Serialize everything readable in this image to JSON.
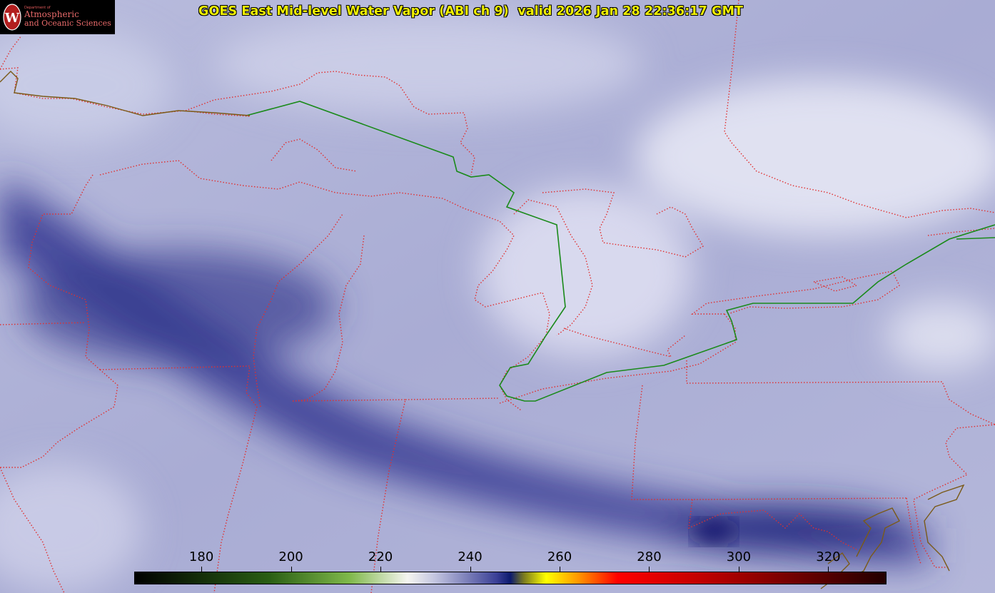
{
  "title": "GOES East Mid-level Water Vapor (ABI ch 9)  valid 2026 Jan 28 22:36:17 GMT",
  "logo": {
    "department": "Department of",
    "line1": "Atmospheric",
    "line2": "and Oceanic Sciences",
    "seal_letter": "W"
  },
  "colorbar": {
    "min": 165,
    "max": 333,
    "ticks": [
      180,
      200,
      220,
      240,
      260,
      280,
      300,
      320
    ],
    "stops": [
      {
        "value": 165,
        "color": "#000000"
      },
      {
        "value": 195,
        "color": "#2a5e14"
      },
      {
        "value": 213,
        "color": "#7fb84a"
      },
      {
        "value": 226,
        "color": "#f5f5f0"
      },
      {
        "value": 232,
        "color": "#c4c6e0"
      },
      {
        "value": 246,
        "color": "#3a3f96"
      },
      {
        "value": 249,
        "color": "#0c1a6e"
      },
      {
        "value": 252,
        "color": "#7a7a20"
      },
      {
        "value": 257,
        "color": "#ffff00"
      },
      {
        "value": 264,
        "color": "#ff9a00"
      },
      {
        "value": 273,
        "color": "#ff0000"
      },
      {
        "value": 292,
        "color": "#c00000"
      },
      {
        "value": 333,
        "color": "#220000"
      }
    ]
  },
  "colors": {
    "border_lines": "#e03030",
    "country_border": "#1a8a1a",
    "coastline": "#8a5a1a",
    "title_text": "#f0f000",
    "logo_text": "#e86a6a"
  }
}
